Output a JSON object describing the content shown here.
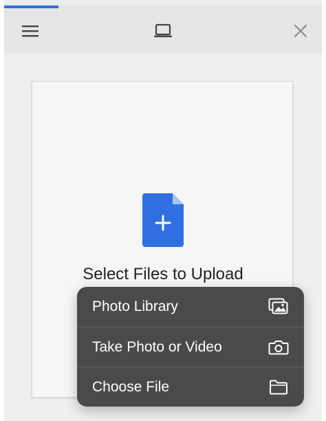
{
  "toolbar": {
    "menu_icon": "hamburger-menu-icon",
    "device_icon": "laptop-icon",
    "close_icon": "close-icon"
  },
  "progress": {
    "fraction": 0.17,
    "color": "#2f6fe0"
  },
  "upload": {
    "icon": "new-file-plus-icon",
    "title": "Select Files to Upload",
    "accent": "#2f6fe0"
  },
  "menu": {
    "items": [
      {
        "label": "Photo Library",
        "icon": "photo-library-icon"
      },
      {
        "label": "Take Photo or Video",
        "icon": "camera-icon"
      },
      {
        "label": "Choose File",
        "icon": "folder-icon"
      }
    ]
  }
}
